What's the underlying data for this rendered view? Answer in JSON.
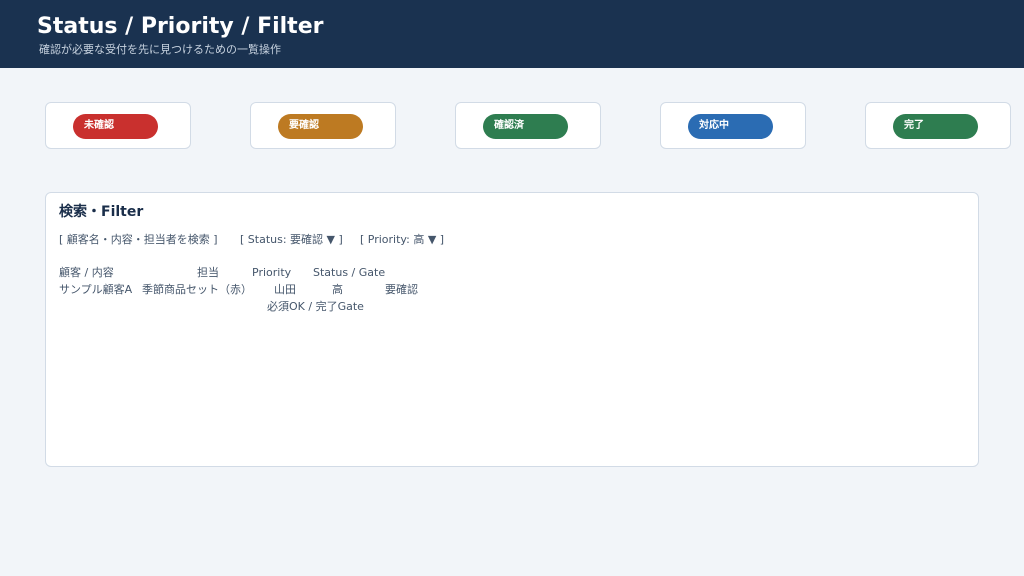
{
  "header": {
    "title": "Status / Priority / Filter",
    "subtitle": "確認が必要な受付を先に見つけるための一覧操作"
  },
  "status_cards": [
    {
      "label": "未確認",
      "color": "#c9302e"
    },
    {
      "label": "要確認",
      "color": "#bd7a22"
    },
    {
      "label": "確認済",
      "color": "#2e7d50"
    },
    {
      "label": "対応中",
      "color": "#2b6cb3"
    },
    {
      "label": "完了",
      "color": "#2e7d50"
    }
  ],
  "filter_panel": {
    "title": "検索・Filter",
    "search_label": "[ 顧客名・内容・担当者を検索 ]",
    "status_filter": "[ Status: 要確認 ▼ ]",
    "priority_filter": "[ Priority: 高 ▼ ]"
  },
  "table": {
    "columns": [
      "顧客 / 内容",
      "担当",
      "Priority",
      "Status / Gate"
    ],
    "rows": [
      {
        "customer": "サンプル顧客A",
        "content": "季節商品セット（赤）",
        "assignee": "山田",
        "priority": "高",
        "status": "要確認",
        "gate": "必須OK / 完了Gate"
      }
    ]
  }
}
